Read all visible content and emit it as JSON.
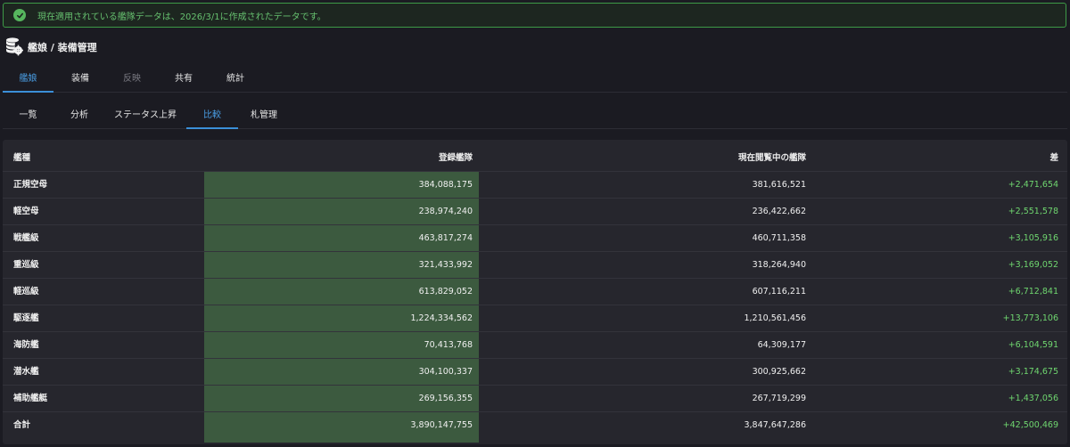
{
  "alert": {
    "icon": "check-circle-icon",
    "text": "現在適用されている艦隊データは、2026/3/1に作成されたデータです。",
    "color": "#3d9a47"
  },
  "header": {
    "icon": "database-gear-icon",
    "title": "艦娘 / 装備管理"
  },
  "tabs": [
    {
      "label": "艦娘",
      "state": "active"
    },
    {
      "label": "装備",
      "state": "normal"
    },
    {
      "label": "反映",
      "state": "disabled"
    },
    {
      "label": "共有",
      "state": "normal"
    },
    {
      "label": "統計",
      "state": "normal"
    }
  ],
  "subtabs": [
    {
      "label": "一覧",
      "state": "normal"
    },
    {
      "label": "分析",
      "state": "normal"
    },
    {
      "label": "ステータス上昇",
      "state": "normal"
    },
    {
      "label": "比較",
      "state": "active"
    },
    {
      "label": "札管理",
      "state": "normal"
    }
  ],
  "table": {
    "headers": [
      "艦種",
      "登録艦隊",
      "現在閲覧中の艦隊",
      "差"
    ],
    "rows": [
      [
        "正規空母",
        "384,088,175",
        "381,616,521",
        "+2,471,654"
      ],
      [
        "軽空母",
        "238,974,240",
        "236,422,662",
        "+2,551,578"
      ],
      [
        "戦艦級",
        "463,817,274",
        "460,711,358",
        "+3,105,916"
      ],
      [
        "重巡級",
        "321,433,992",
        "318,264,940",
        "+3,169,052"
      ],
      [
        "軽巡級",
        "613,829,052",
        "607,116,211",
        "+6,712,841"
      ],
      [
        "駆逐艦",
        "1,224,334,562",
        "1,210,561,456",
        "+13,773,106"
      ],
      [
        "海防艦",
        "70,413,768",
        "64,309,177",
        "+6,104,591"
      ],
      [
        "潜水艦",
        "304,100,337",
        "300,925,662",
        "+3,174,675"
      ],
      [
        "補助艦艇",
        "269,156,355",
        "267,719,299",
        "+1,437,056"
      ],
      [
        "合計",
        "3,890,147,755",
        "3,847,647,286",
        "+42,500,469"
      ]
    ]
  },
  "colors": {
    "accent": "#3b8fd8",
    "positive": "#6fd66f",
    "highlight_column": "#3c5a3f",
    "background": "#1b1b22"
  }
}
